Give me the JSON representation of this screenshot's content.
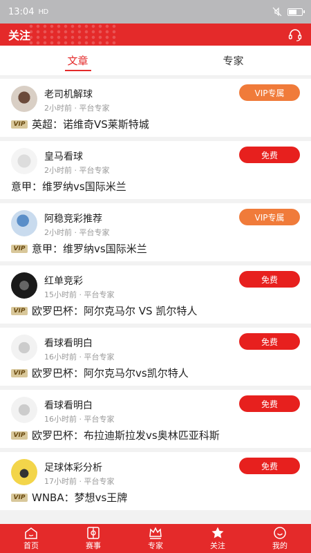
{
  "status_bar": {
    "time": "13:04",
    "network": "HD",
    "icons": [
      "mute-icon",
      "battery-icon"
    ]
  },
  "header": {
    "title": "关注",
    "support_icon": "headset-icon"
  },
  "tabs": [
    {
      "label": "文章",
      "active": true
    },
    {
      "label": "专家",
      "active": false
    }
  ],
  "feed": [
    {
      "author": "老司机解球",
      "time": "2小时前",
      "source": "平台专家",
      "badge": "VIP专属",
      "badge_type": "vip",
      "vip": true,
      "title": "英超：诺维奇VS莱斯特城"
    },
    {
      "author": "皇马看球",
      "time": "2小时前",
      "source": "平台专家",
      "badge": "免费",
      "badge_type": "free",
      "vip": false,
      "title": "意甲：维罗纳vs国际米兰"
    },
    {
      "author": "阿稳竞彩推荐",
      "time": "2小时前",
      "source": "平台专家",
      "badge": "VIP专属",
      "badge_type": "vip",
      "vip": true,
      "title": "意甲：维罗纳vs国际米兰"
    },
    {
      "author": "红单竞彩",
      "time": "15小时前",
      "source": "平台专家",
      "badge": "免费",
      "badge_type": "free",
      "vip": true,
      "title": "欧罗巴杯：阿尔克马尔 VS 凯尔特人"
    },
    {
      "author": "看球看明白",
      "time": "16小时前",
      "source": "平台专家",
      "badge": "免费",
      "badge_type": "free",
      "vip": true,
      "title": "欧罗巴杯：阿尔克马尔vs凯尔特人"
    },
    {
      "author": "看球看明白",
      "time": "16小时前",
      "source": "平台专家",
      "badge": "免费",
      "badge_type": "free",
      "vip": true,
      "title": "欧罗巴杯：布拉迪斯拉发vs奥林匹亚科斯"
    },
    {
      "author": "足球体彩分析",
      "time": "17小时前",
      "source": "平台专家",
      "badge": "免费",
      "badge_type": "free",
      "vip": true,
      "title": "WNBA：梦想vs王牌"
    }
  ],
  "vip_tag": "VIP",
  "meta_separator": " · ",
  "bottom_nav": [
    {
      "label": "首页",
      "icon": "home-icon"
    },
    {
      "label": "赛事",
      "icon": "match-icon"
    },
    {
      "label": "专家",
      "icon": "crown-icon"
    },
    {
      "label": "关注",
      "icon": "star-icon"
    },
    {
      "label": "我的",
      "icon": "smile-icon"
    }
  ]
}
